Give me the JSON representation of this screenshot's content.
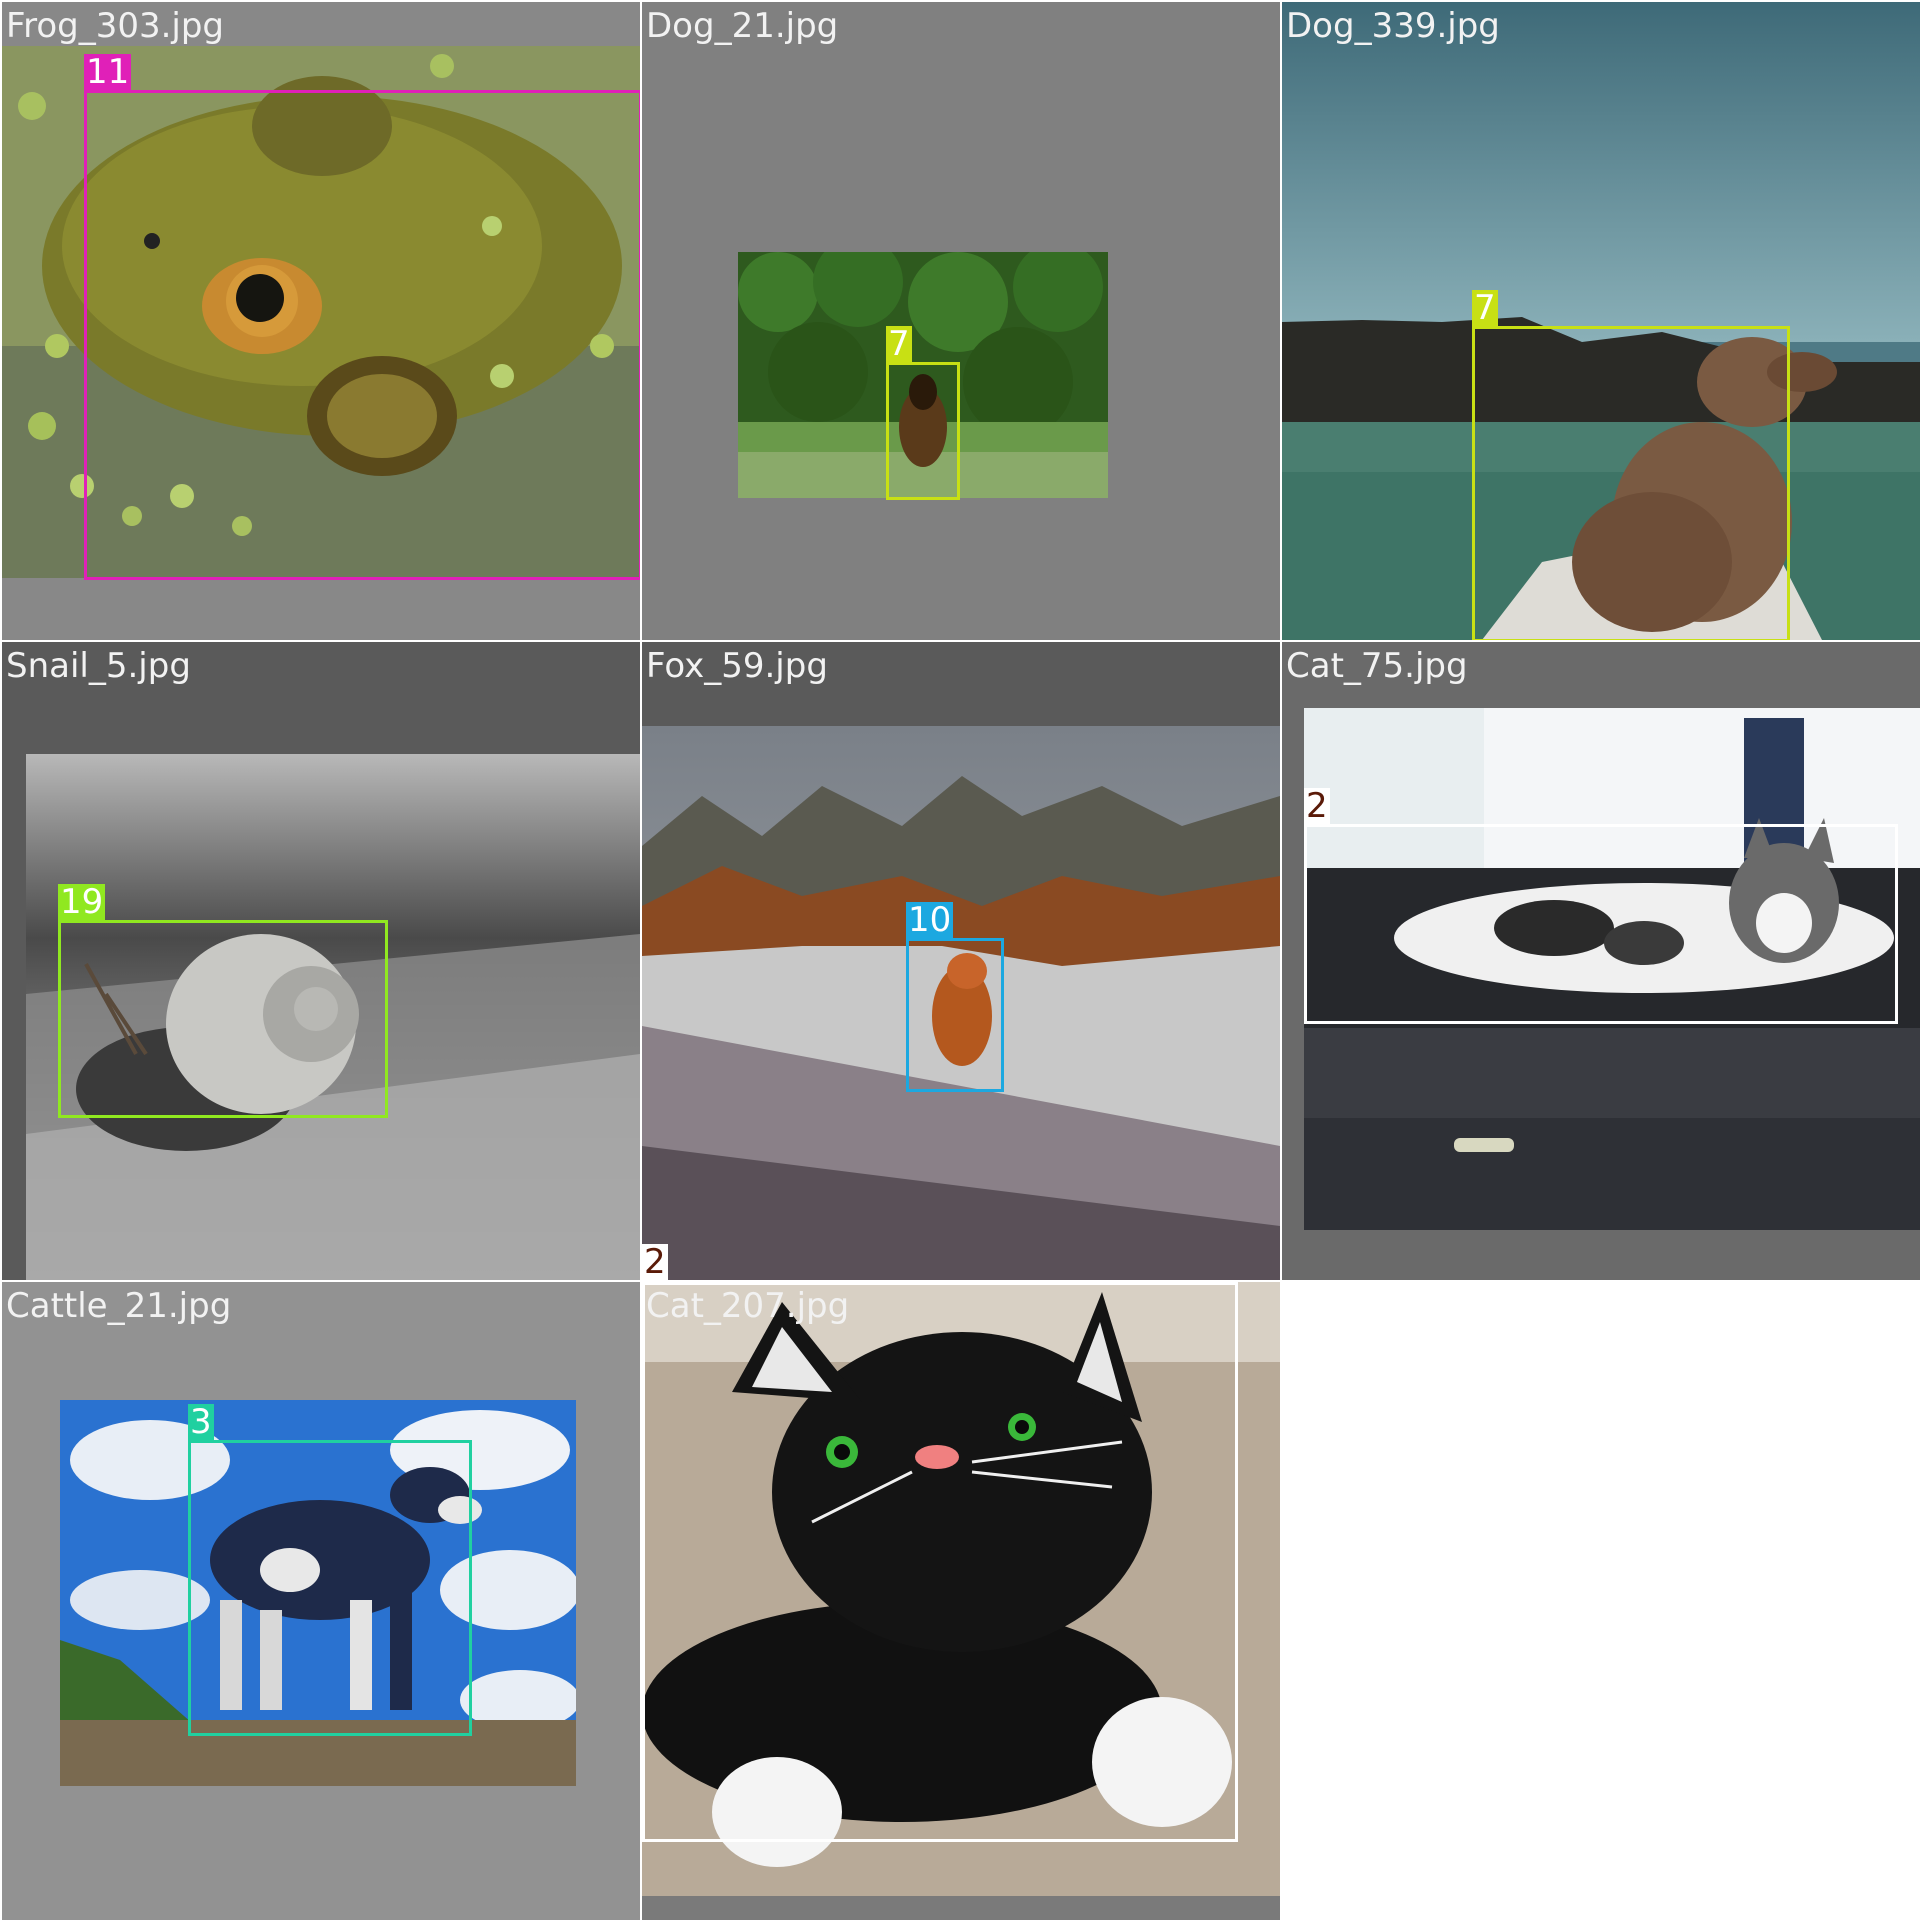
{
  "tiles": [
    {
      "filename": "Frog_303.jpg",
      "boxes": [
        {
          "class_id": "11",
          "color": "#e020b8"
        }
      ]
    },
    {
      "filename": "Dog_21.jpg",
      "boxes": [
        {
          "class_id": "7",
          "color": "#c8e014"
        }
      ]
    },
    {
      "filename": "Dog_339.jpg",
      "boxes": [
        {
          "class_id": "7",
          "color": "#c8e014"
        }
      ]
    },
    {
      "filename": "Snail_5.jpg",
      "boxes": [
        {
          "class_id": "19",
          "color": "#90e820"
        }
      ]
    },
    {
      "filename": "Fox_59.jpg",
      "boxes": [
        {
          "class_id": "10",
          "color": "#1ca8e0"
        }
      ],
      "extra_label": "2"
    },
    {
      "filename": "Cat_75.jpg",
      "boxes": [
        {
          "class_id": "2",
          "color": "#ffffff"
        }
      ]
    },
    {
      "filename": "Cattle_21.jpg",
      "boxes": [
        {
          "class_id": "3",
          "color": "#20d0a0"
        }
      ]
    },
    {
      "filename": "Cat_207.jpg",
      "boxes": [
        {
          "class_id": "2",
          "color": "#ffffff"
        }
      ]
    }
  ]
}
